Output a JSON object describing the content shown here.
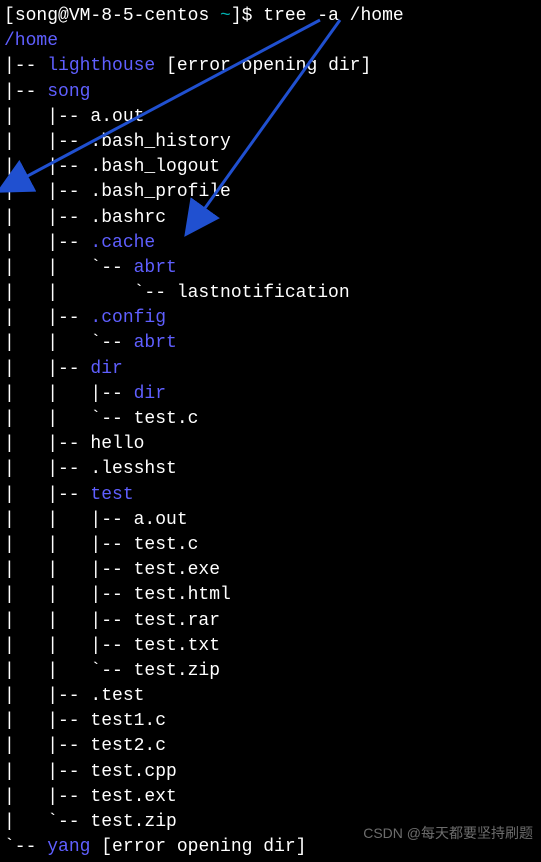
{
  "prompt": {
    "open_bracket": "[",
    "user": "song@VM-8-5-centos",
    "tilde": " ~",
    "close_bracket": "]$ ",
    "command": "tree -a /home"
  },
  "tree": {
    "root": "/home",
    "lines": [
      {
        "prefix": "|-- ",
        "name": "lighthouse",
        "suffix": " [error opening dir]",
        "is_dir": true
      },
      {
        "prefix": "|-- ",
        "name": "song",
        "suffix": "",
        "is_dir": true
      },
      {
        "prefix": "|   |-- ",
        "name": "a.out",
        "suffix": "",
        "is_dir": false
      },
      {
        "prefix": "|   |-- ",
        "name": ".bash_history",
        "suffix": "",
        "is_dir": false
      },
      {
        "prefix": "|   |-- ",
        "name": ".bash_logout",
        "suffix": "",
        "is_dir": false
      },
      {
        "prefix": "|   |-- ",
        "name": ".bash_profile",
        "suffix": "",
        "is_dir": false
      },
      {
        "prefix": "|   |-- ",
        "name": ".bashrc",
        "suffix": "",
        "is_dir": false
      },
      {
        "prefix": "|   |-- ",
        "name": ".cache",
        "suffix": "",
        "is_dir": true
      },
      {
        "prefix": "|   |   `-- ",
        "name": "abrt",
        "suffix": "",
        "is_dir": true
      },
      {
        "prefix": "|   |       `-- ",
        "name": "lastnotification",
        "suffix": "",
        "is_dir": false
      },
      {
        "prefix": "|   |-- ",
        "name": ".config",
        "suffix": "",
        "is_dir": true
      },
      {
        "prefix": "|   |   `-- ",
        "name": "abrt",
        "suffix": "",
        "is_dir": true
      },
      {
        "prefix": "|   |-- ",
        "name": "dir",
        "suffix": "",
        "is_dir": true
      },
      {
        "prefix": "|   |   |-- ",
        "name": "dir",
        "suffix": "",
        "is_dir": true
      },
      {
        "prefix": "|   |   `-- ",
        "name": "test.c",
        "suffix": "",
        "is_dir": false
      },
      {
        "prefix": "|   |-- ",
        "name": "hello",
        "suffix": "",
        "is_dir": false
      },
      {
        "prefix": "|   |-- ",
        "name": ".lesshst",
        "suffix": "",
        "is_dir": false
      },
      {
        "prefix": "|   |-- ",
        "name": "test",
        "suffix": "",
        "is_dir": true
      },
      {
        "prefix": "|   |   |-- ",
        "name": "a.out",
        "suffix": "",
        "is_dir": false
      },
      {
        "prefix": "|   |   |-- ",
        "name": "test.c",
        "suffix": "",
        "is_dir": false
      },
      {
        "prefix": "|   |   |-- ",
        "name": "test.exe",
        "suffix": "",
        "is_dir": false
      },
      {
        "prefix": "|   |   |-- ",
        "name": "test.html",
        "suffix": "",
        "is_dir": false
      },
      {
        "prefix": "|   |   |-- ",
        "name": "test.rar",
        "suffix": "",
        "is_dir": false
      },
      {
        "prefix": "|   |   |-- ",
        "name": "test.txt",
        "suffix": "",
        "is_dir": false
      },
      {
        "prefix": "|   |   `-- ",
        "name": "test.zip",
        "suffix": "",
        "is_dir": false
      },
      {
        "prefix": "|   |-- ",
        "name": ".test",
        "suffix": "",
        "is_dir": false
      },
      {
        "prefix": "|   |-- ",
        "name": "test1.c",
        "suffix": "",
        "is_dir": false
      },
      {
        "prefix": "|   |-- ",
        "name": "test2.c",
        "suffix": "",
        "is_dir": false
      },
      {
        "prefix": "|   |-- ",
        "name": "test.cpp",
        "suffix": "",
        "is_dir": false
      },
      {
        "prefix": "|   |-- ",
        "name": "test.ext",
        "suffix": "",
        "is_dir": false
      },
      {
        "prefix": "|   `-- ",
        "name": "test.zip",
        "suffix": "",
        "is_dir": false
      },
      {
        "prefix": "`-- ",
        "name": "yang",
        "suffix": " [error opening dir]",
        "is_dir": true
      }
    ]
  },
  "watermark": "CSDN @每天都要坚持刷题"
}
